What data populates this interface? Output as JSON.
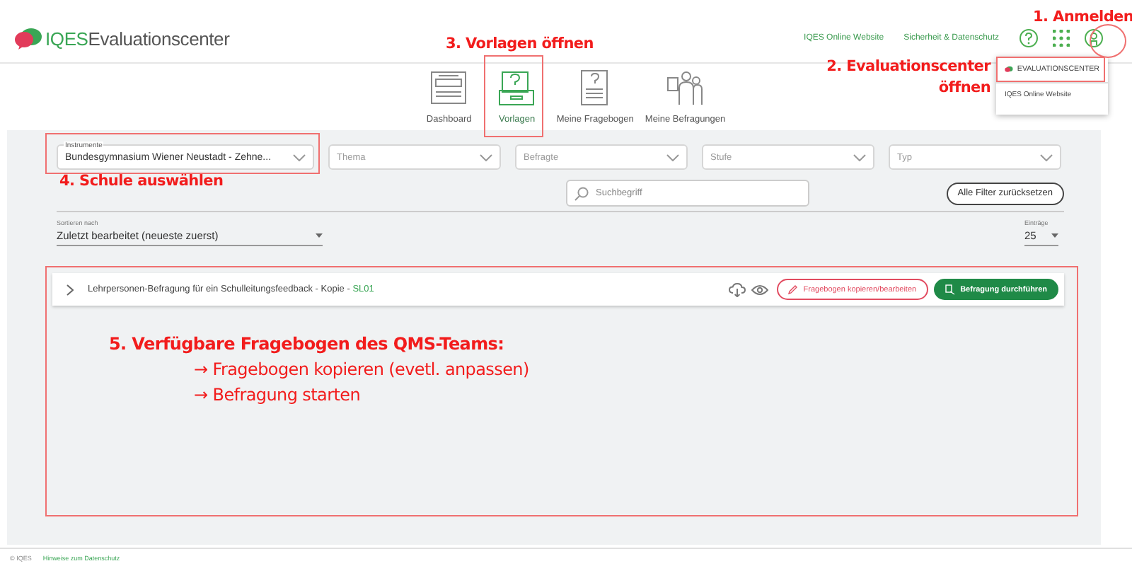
{
  "header": {
    "logo": "IQES",
    "title": "Evaluationscenter",
    "links": [
      "IQES Online Website",
      "Sicherheit & Datenschutz"
    ]
  },
  "nav": [
    {
      "label": "Dashboard",
      "selected": false,
      "kind": "dashboard"
    },
    {
      "label": "Vorlagen",
      "selected": true,
      "kind": "templates"
    },
    {
      "label": "Meine Fragebogen",
      "selected": false,
      "kind": "questionnaires"
    },
    {
      "label": "Meine Befragungen",
      "selected": false,
      "kind": "surveys"
    }
  ],
  "account_menu": {
    "items": [
      {
        "label": "EVALUATIONSCENTER",
        "selected": true
      },
      {
        "label": "IQES Online Website",
        "selected": false
      }
    ]
  },
  "filters": [
    {
      "label": "Instrumente",
      "value": "Bundesgymnasium Wiener Neustadt - Zehne..."
    },
    {
      "placeholder": "Thema"
    },
    {
      "placeholder": "Befragte"
    },
    {
      "placeholder": "Stufe"
    },
    {
      "placeholder": "Typ"
    }
  ],
  "search": {
    "placeholder": "Suchbegriff"
  },
  "reset_button": "Alle Filter zurücksetzen",
  "sort": {
    "label": "Sortieren nach",
    "value": "Zuletzt bearbeitet (neueste zuerst)"
  },
  "entries": {
    "label": "Einträge",
    "value": "25"
  },
  "results": [
    {
      "title": "Lehrpersonen-Befragung für ein Schulleitungsfeedback - Kopie - ",
      "code": "SL01",
      "actions": [
        "Fragebogen kopieren/bearbeiten",
        "Befragung durchführen"
      ]
    }
  ],
  "annotations": [
    "1. Anmelden",
    "2. Evaluationscenter öffnen",
    "3. Vorlagen öffnen",
    "4. Schule auswählen"
  ],
  "note": {
    "heading": "5. Verfügbare Fragebogen des QMS-Teams:",
    "lines": [
      "→ Fragebogen kopieren (evetl. anpassen)",
      "→ Befragung starten"
    ]
  },
  "footer": {
    "copyright": "© IQES",
    "link": "Hinweise zum Datenschutz"
  }
}
